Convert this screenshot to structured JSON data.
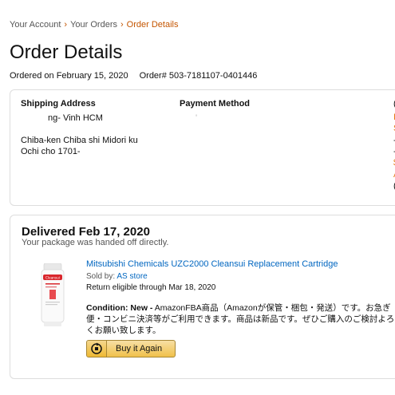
{
  "breadcrumb": {
    "your_account": "Your Account",
    "separator": "›",
    "your_orders": "Your Orders",
    "current": "Order Details"
  },
  "page": {
    "title": "Order Details",
    "ordered_on": "Ordered on February 15, 2020",
    "order_number": "Order# 503-7181107-0401446"
  },
  "summary": {
    "shipping_heading": "Shipping Address",
    "shipping_lines": [
      "ng- Vinh HCM",
      "Chiba-ken Chiba shi Midori ku",
      "Ochi cho 1701-"
    ],
    "payment_heading": "Payment Method",
    "payment_value": "'",
    "edge_glyphs": [
      "(",
      "I",
      "S",
      "-",
      "-",
      "$",
      "A",
      "("
    ]
  },
  "shipment": {
    "status": "Delivered Feb 17, 2020",
    "status_detail": "Your package was handed off directly.",
    "item": {
      "title": "Mitsubishi Chemicals UZC2000 Cleansui Replacement Cartridge",
      "sold_by_label": "Sold by:",
      "seller": "AS store",
      "return_eligibility": "Return eligible through Mar 18, 2020",
      "condition_label": "Condition: New -",
      "condition_text": " AmazonFBA商品（Amazonが保管・梱包・発送）です。お急ぎ便・コンビニ決済等がご利用できます。商品は新品です。ぜひご購入のご検討よろしくお願い致します。",
      "image_brand": "Cleansui"
    },
    "buy_again_label": "Buy it Again"
  },
  "colors": {
    "link": "#0066c0",
    "breadcrumb_current": "#c45500",
    "button_gradient_top": "#f7dfa5",
    "button_gradient_bottom": "#f0c14b"
  }
}
